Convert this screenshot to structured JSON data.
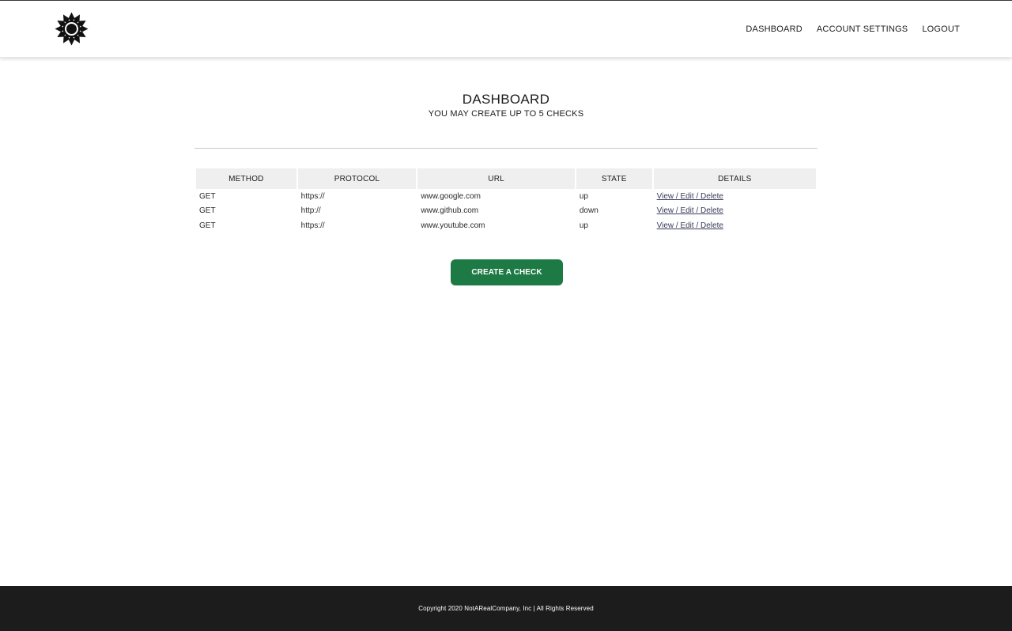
{
  "header": {
    "logo_icon": "flower-logo-icon",
    "nav": [
      {
        "label": "DASHBOARD"
      },
      {
        "label": "ACCOUNT SETTINGS"
      },
      {
        "label": "LOGOUT"
      }
    ]
  },
  "main": {
    "title": "DASHBOARD",
    "subtitle": "YOU MAY CREATE UP TO 5 CHECKS",
    "table": {
      "columns": [
        "METHOD",
        "PROTOCOL",
        "URL",
        "STATE",
        "DETAILS"
      ],
      "rows": [
        {
          "method": "GET",
          "protocol": "https://",
          "url": "www.google.com",
          "state": "up",
          "details": "View / Edit / Delete"
        },
        {
          "method": "GET",
          "protocol": "http://",
          "url": "www.github.com",
          "state": "down",
          "details": "View / Edit / Delete"
        },
        {
          "method": "GET",
          "protocol": "https://",
          "url": "www.youtube.com",
          "state": "up",
          "details": "View / Edit / Delete"
        }
      ]
    },
    "create_button": "CREATE A CHECK"
  },
  "footer": {
    "copyright": "Copyright 2020 NotARealCompany, Inc | All Rights Reserved"
  },
  "colors": {
    "accent_green": "#1e7a45",
    "footer_bg": "#1c1c1c",
    "table_header_bg": "#efefef"
  }
}
